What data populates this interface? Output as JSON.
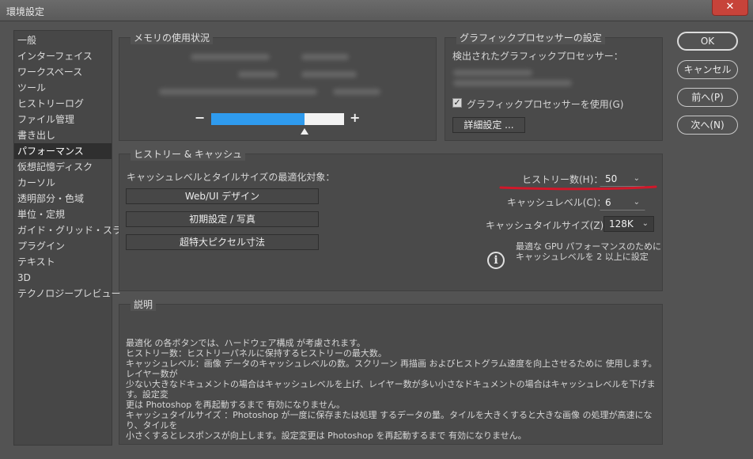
{
  "window": {
    "title": "環境設定",
    "close_label": "✕"
  },
  "nav": {
    "items": [
      {
        "label": "一般"
      },
      {
        "label": "インターフェイス"
      },
      {
        "label": "ワークスペース"
      },
      {
        "label": "ツール"
      },
      {
        "label": "ヒストリーログ"
      },
      {
        "label": "ファイル管理"
      },
      {
        "label": "書き出し"
      },
      {
        "label": "パフォーマンス",
        "selected": true
      },
      {
        "label": "仮想記憶ディスク"
      },
      {
        "label": "カーソル"
      },
      {
        "label": "透明部分・色域"
      },
      {
        "label": "単位・定規"
      },
      {
        "label": "ガイド・グリッド・スライス"
      },
      {
        "label": "プラグイン"
      },
      {
        "label": "テキスト"
      },
      {
        "label": "3D"
      },
      {
        "label": "テクノロジープレビュー"
      }
    ]
  },
  "actions": {
    "ok": "OK",
    "cancel": "キャンセル",
    "prev": "前へ(P)",
    "next": "次へ(N)"
  },
  "memory": {
    "title": "メモリの使用状況",
    "minus": "−",
    "plus": "+",
    "usage_fraction": 0.7
  },
  "gpu": {
    "title": "グラフィックプロセッサーの設定",
    "detected_label": "検出されたグラフィックプロセッサー：",
    "use_gpu_label": "グラフィックプロセッサーを使用(G)",
    "use_gpu_checked": true,
    "check_mark": "✓",
    "advanced_button": "詳細設定 ..."
  },
  "history_cache": {
    "title": "ヒストリー & キャッシュ",
    "optimize_label": "キャッシュレベルとタイルサイズの最適化対象：",
    "presets": [
      "Web/UI デザイン",
      "初期設定 / 写真",
      "超特大ピクセル寸法"
    ],
    "history_states_label": "ヒストリー数(H)：",
    "history_states_value": "50",
    "cache_levels_label": "キャッシュレベル(C)：",
    "cache_levels_value": "6",
    "tile_size_label": "キャッシュタイルサイズ(Z)：",
    "tile_size_value": "128K",
    "chevron": "⌄",
    "info_icon": "i",
    "info_line1": "最適な GPU パフォーマンスのために",
    "info_line2": "キャッシュレベルを 2 以上に設定",
    "annotation_color": "#d0182a"
  },
  "description": {
    "title": "説明",
    "lines": [
      "最適化 の各ボタンでは、ハードウェア構成 が考慮されます。",
      "ヒストリー数：ヒストリーパネルに保持するヒストリーの最大数。",
      "キャッシュレベル：画像 データのキャッシュレベルの数。スクリーン 再描画 およびヒストグラム速度を向上させるために 使用します。レイヤー数が",
      "少ない大きなドキュメントの場合はキャッシュレベルを上げ、レイヤー数が多い小さなドキュメントの場合はキャッシュレベルを下げます。設定変",
      "更は Photoshop を再起動するまで 有効になりません。",
      "キャッシュタイルサイズ ：Photoshop が一度に保存または処理 するデータの量。タイルを大きくすると大きな画像 の処理が高速になり、タイルを",
      "小さくするとレスポンスが向上します。設定変更は Photoshop を再起動するまで 有効になりません。"
    ]
  }
}
